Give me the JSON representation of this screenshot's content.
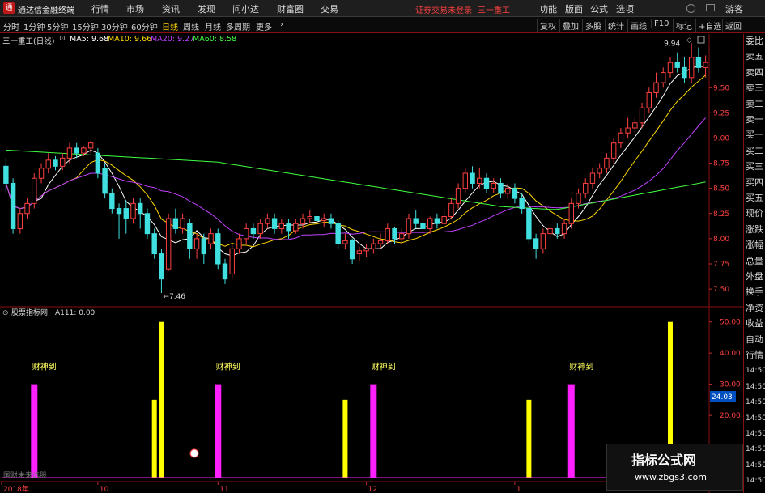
{
  "titlebar": {
    "app_name": "通达信金融终端",
    "menu": [
      "行情",
      "市场",
      "资讯",
      "发现",
      "问小达",
      "财富圈",
      "交易"
    ],
    "status": "证券交易未登录",
    "stock_name": "三一重工",
    "right": [
      "功能",
      "版面",
      "公式",
      "选项"
    ],
    "guest": "游客"
  },
  "toolbar": {
    "periods": [
      "分时",
      "1分钟",
      "5分钟",
      "15分钟",
      "30分钟",
      "60分钟",
      "日线",
      "周线",
      "月线",
      "多周期",
      "更多"
    ],
    "active_period": "日线",
    "right": [
      "复权",
      "叠加",
      "多股",
      "统计",
      "画线",
      "F10",
      "标记",
      "+自选",
      "返回"
    ]
  },
  "indicator_line": {
    "title": "三一重工(日线)",
    "ma5": "MA5: 9.68",
    "ma10": "MA10: 9.66",
    "ma20": "MA20: 9.27",
    "ma60": "MA60: 8.58"
  },
  "colors": {
    "up": "#ff4040",
    "down": "#40e0e0",
    "ma5": "#ffffff",
    "ma10": "#ffd700",
    "ma20": "#c040ff",
    "ma60": "#40ff40",
    "magenta_bar": "#ff20ff",
    "yellow_bar": "#ffff00",
    "frame": "#8a1010"
  },
  "price_chart": {
    "y_ticks": [
      "9.50",
      "9.25",
      "9.00",
      "8.75",
      "8.50",
      "8.25",
      "8.00",
      "7.75",
      "7.50"
    ],
    "y_tick_values": [
      9.5,
      9.25,
      9.0,
      8.75,
      8.5,
      8.25,
      8.0,
      7.75,
      7.5
    ],
    "ylim": [
      7.34,
      9.92
    ],
    "high_label": "9.94",
    "low_label": "7.46",
    "candles": [
      [
        8.72,
        8.55,
        8.8,
        8.45
      ],
      [
        8.55,
        8.1,
        8.6,
        8.05
      ],
      [
        8.1,
        8.25,
        8.3,
        8.05
      ],
      [
        8.25,
        8.35,
        8.4,
        8.2
      ],
      [
        8.35,
        8.6,
        8.65,
        8.3
      ],
      [
        8.6,
        8.7,
        8.75,
        8.55
      ],
      [
        8.7,
        8.78,
        8.85,
        8.65
      ],
      [
        8.78,
        8.72,
        8.82,
        8.68
      ],
      [
        8.72,
        8.8,
        8.85,
        8.68
      ],
      [
        8.8,
        8.9,
        8.95,
        8.75
      ],
      [
        8.9,
        8.85,
        8.95,
        8.8
      ],
      [
        8.85,
        8.9,
        8.92,
        8.82
      ],
      [
        8.9,
        8.95,
        8.97,
        8.85
      ],
      [
        8.85,
        8.65,
        8.9,
        8.6
      ],
      [
        8.7,
        8.45,
        8.75,
        8.4
      ],
      [
        8.45,
        8.3,
        8.5,
        8.25
      ],
      [
        8.3,
        8.25,
        8.35,
        8.0
      ],
      [
        8.3,
        8.2,
        8.38,
        8.05
      ],
      [
        8.2,
        8.35,
        8.4,
        8.15
      ],
      [
        8.35,
        8.25,
        8.4,
        8.1
      ],
      [
        8.25,
        8.05,
        8.3,
        8.0
      ],
      [
        8.05,
        7.85,
        8.1,
        7.8
      ],
      [
        7.85,
        7.6,
        7.9,
        7.46
      ],
      [
        7.7,
        8.2,
        8.25,
        7.68
      ],
      [
        8.2,
        8.1,
        8.3,
        8.05
      ],
      [
        8.1,
        8.2,
        8.25,
        8.05
      ],
      [
        8.15,
        7.9,
        8.2,
        7.8
      ],
      [
        7.9,
        8.0,
        8.05,
        7.8
      ],
      [
        8.0,
        7.85,
        8.05,
        7.75
      ],
      [
        7.95,
        8.05,
        8.1,
        7.9
      ],
      [
        8.05,
        7.75,
        8.1,
        7.7
      ],
      [
        7.75,
        7.6,
        7.8,
        7.55
      ],
      [
        7.65,
        7.9,
        7.95,
        7.6
      ],
      [
        7.9,
        8.0,
        8.05,
        7.85
      ],
      [
        8.0,
        8.1,
        8.15,
        7.95
      ],
      [
        8.1,
        8.05,
        8.15,
        8.0
      ],
      [
        8.05,
        8.15,
        8.2,
        8.0
      ],
      [
        8.15,
        8.2,
        8.25,
        8.1
      ],
      [
        8.2,
        8.1,
        8.25,
        8.05
      ],
      [
        8.1,
        8.15,
        8.2,
        8.05
      ],
      [
        8.15,
        8.08,
        8.2,
        8.0
      ],
      [
        8.08,
        8.15,
        8.2,
        8.05
      ],
      [
        8.15,
        8.2,
        8.25,
        8.1
      ],
      [
        8.2,
        8.22,
        8.28,
        8.15
      ],
      [
        8.22,
        8.18,
        8.25,
        8.1
      ],
      [
        8.18,
        8.2,
        8.25,
        8.12
      ],
      [
        8.2,
        8.15,
        8.25,
        8.1
      ],
      [
        8.15,
        7.95,
        8.18,
        7.9
      ],
      [
        7.95,
        7.98,
        8.05,
        7.9
      ],
      [
        7.98,
        7.8,
        8.0,
        7.75
      ],
      [
        7.85,
        7.88,
        7.92,
        7.78
      ],
      [
        7.88,
        7.9,
        7.95,
        7.82
      ],
      [
        7.9,
        7.95,
        8.0,
        7.85
      ],
      [
        7.95,
        7.98,
        8.05,
        7.9
      ],
      [
        7.98,
        8.1,
        8.15,
        7.95
      ],
      [
        8.1,
        8.0,
        8.12,
        7.95
      ],
      [
        8.0,
        8.05,
        8.1,
        7.95
      ],
      [
        8.05,
        8.2,
        8.25,
        8.0
      ],
      [
        8.2,
        8.15,
        8.28,
        8.1
      ],
      [
        8.15,
        8.1,
        8.2,
        8.05
      ],
      [
        8.1,
        8.2,
        8.22,
        8.05
      ],
      [
        8.2,
        8.15,
        8.25,
        8.1
      ],
      [
        8.15,
        8.22,
        8.28,
        8.1
      ],
      [
        8.22,
        8.35,
        8.4,
        8.2
      ],
      [
        8.35,
        8.5,
        8.55,
        8.3
      ],
      [
        8.5,
        8.65,
        8.7,
        8.45
      ],
      [
        8.65,
        8.55,
        8.72,
        8.5
      ],
      [
        8.55,
        8.6,
        8.7,
        8.5
      ],
      [
        8.6,
        8.5,
        8.65,
        8.45
      ],
      [
        8.5,
        8.55,
        8.6,
        8.45
      ],
      [
        8.55,
        8.45,
        8.6,
        8.4
      ],
      [
        8.45,
        8.5,
        8.55,
        8.4
      ],
      [
        8.5,
        8.4,
        8.55,
        8.35
      ],
      [
        8.4,
        8.3,
        8.45,
        8.25
      ],
      [
        8.3,
        8.0,
        8.35,
        7.95
      ],
      [
        8.0,
        7.9,
        8.05,
        7.8
      ],
      [
        7.9,
        8.05,
        8.1,
        7.85
      ],
      [
        8.05,
        8.1,
        8.15,
        8.0
      ],
      [
        8.1,
        8.05,
        8.15,
        8.0
      ],
      [
        8.05,
        8.15,
        8.2,
        8.0
      ],
      [
        8.15,
        8.35,
        8.4,
        8.1
      ],
      [
        8.35,
        8.45,
        8.5,
        8.3
      ],
      [
        8.45,
        8.55,
        8.6,
        8.4
      ],
      [
        8.55,
        8.65,
        8.7,
        8.5
      ],
      [
        8.65,
        8.7,
        8.75,
        8.6
      ],
      [
        8.7,
        8.8,
        8.85,
        8.65
      ],
      [
        8.8,
        8.95,
        9.0,
        8.75
      ],
      [
        8.95,
        9.05,
        9.1,
        8.9
      ],
      [
        9.05,
        9.1,
        9.2,
        9.0
      ],
      [
        9.1,
        9.15,
        9.2,
        9.05
      ],
      [
        9.15,
        9.3,
        9.35,
        9.1
      ],
      [
        9.3,
        9.45,
        9.5,
        9.25
      ],
      [
        9.45,
        9.55,
        9.65,
        9.4
      ],
      [
        9.55,
        9.65,
        9.7,
        9.5
      ],
      [
        9.65,
        9.75,
        9.8,
        9.6
      ],
      [
        9.75,
        9.7,
        9.85,
        9.65
      ],
      [
        9.7,
        9.6,
        9.8,
        9.55
      ],
      [
        9.6,
        9.8,
        9.94,
        9.55
      ],
      [
        9.8,
        9.7,
        9.9,
        9.65
      ],
      [
        9.7,
        9.75,
        9.82,
        9.6
      ]
    ]
  },
  "sub_chart": {
    "title": "股票指标网",
    "a111": "A111: 0.00",
    "label": "财神到",
    "y_ticks": [
      "50.00",
      "40.00",
      "30.00",
      "20.00"
    ],
    "y_tick_values": [
      50,
      40,
      30,
      20
    ],
    "ylim": [
      0,
      52
    ],
    "current_value": "24.03",
    "magenta_bars": [
      {
        "i": 4,
        "v": 30
      },
      {
        "i": 30,
        "v": 30
      },
      {
        "i": 52,
        "v": 30
      },
      {
        "i": 80,
        "v": 30
      }
    ],
    "yellow_bars": [
      {
        "i": 21,
        "v": 25
      },
      {
        "i": 22,
        "v": 50
      },
      {
        "i": 48,
        "v": 25
      },
      {
        "i": 74,
        "v": 25
      },
      {
        "i": 94,
        "v": 50
      }
    ],
    "labels": [
      {
        "i": 6
      },
      {
        "i": 32
      },
      {
        "i": 54
      },
      {
        "i": 82
      }
    ],
    "bottom_text": "国财未来选股"
  },
  "x_axis": {
    "labels": [
      "2018年",
      "10",
      "11",
      "12",
      "1"
    ],
    "label_index": [
      0,
      13,
      30,
      51,
      72
    ]
  },
  "right_panel": {
    "items": [
      "委比",
      "卖五",
      "卖四",
      "卖三",
      "卖二",
      "卖一",
      "买一",
      "买二",
      "买三",
      "买四",
      "买五",
      "现价",
      "涨跌",
      "涨幅",
      "总量",
      "外盘",
      "换手",
      "净资",
      "收益",
      "自动",
      "行情",
      "14:50",
      "14:50",
      "14:50",
      "14:50",
      "14:50",
      "14:50",
      "14:50",
      "14:50"
    ]
  },
  "watermark": {
    "line1": "指标公式网",
    "line2": "www.zbgs3.com"
  }
}
